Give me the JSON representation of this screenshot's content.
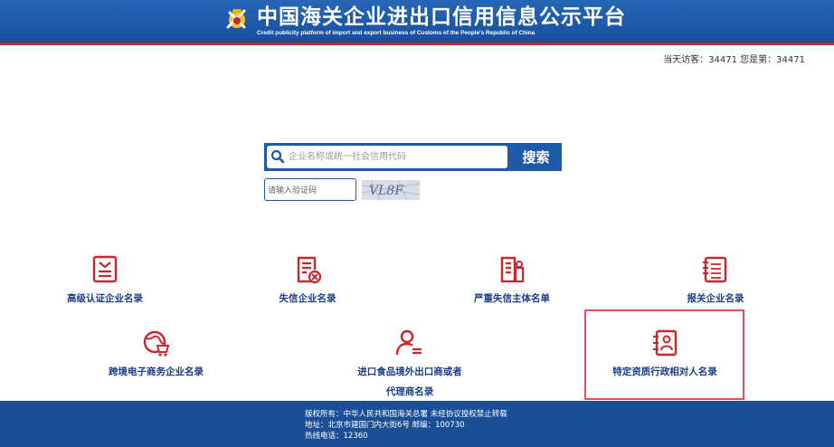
{
  "header": {
    "title": "中国海关企业进出口信用信息公示平台",
    "subtitle": "Credit publicity platform of import and export business of Customs of the People's Republic of China"
  },
  "visitors": {
    "text": "当天访客：34471   您是第：34471"
  },
  "search": {
    "placeholder": "企业名称或统一社会信用代码",
    "button_label": "搜索"
  },
  "captcha": {
    "placeholder": "请输入验证码",
    "code": "VL8F"
  },
  "categories": [
    {
      "label": "高级认证企业名录",
      "icon": "certificate-icon"
    },
    {
      "label": "失信企业名录",
      "icon": "document-x-icon"
    },
    {
      "label": "严重失信主体名单",
      "icon": "building-list-icon"
    },
    {
      "label": "报关企业名录",
      "icon": "notebook-icon"
    },
    {
      "label": "跨境电子商务企业名录",
      "icon": "globe-cart-icon"
    },
    {
      "label_line1": "进口食品境外出口商或者",
      "label_line2": "代理商名录",
      "icon": "person-list-icon"
    },
    {
      "label": "特定资质行政相对人名录",
      "icon": "contact-book-icon"
    }
  ],
  "colors": {
    "brand_blue": "#1e5aa8",
    "icon_red": "#c8272c",
    "label_blue": "#1a3d87",
    "highlight": "#e6505a"
  },
  "footer": {
    "line1": "版权所有：中华人民共和国海关总署   未经协议授权禁止转载",
    "line2": "地址：北京市建国门内大街6号 邮编：100730",
    "line3": "热线电话：12360"
  }
}
